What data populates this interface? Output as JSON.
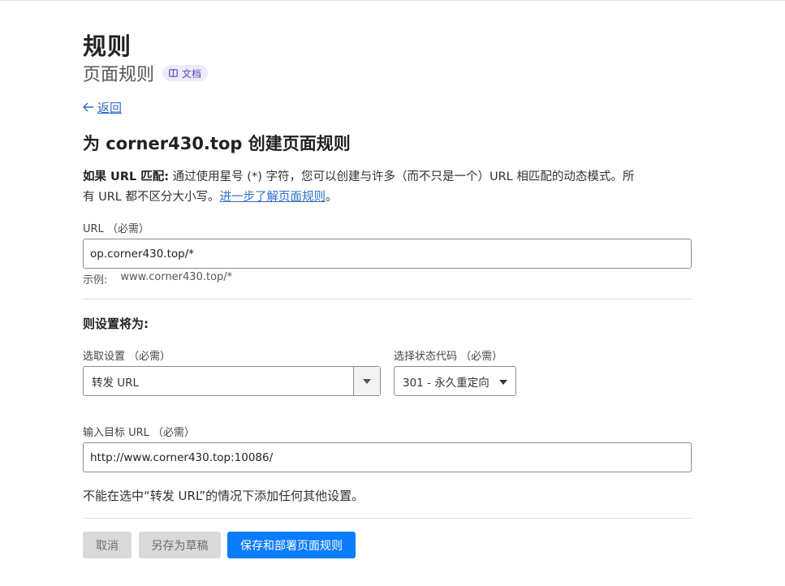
{
  "header": {
    "title": "规则",
    "subtitle": "页面规则",
    "doc_badge": "文档"
  },
  "back_link": "返回",
  "heading": "为 corner430.top 创建页面规则",
  "description": {
    "bold": "如果 URL 匹配:",
    "text_line1": " 通过使用星号 (*) 字符，您可以创建与许多（而不只是一个）URL 相匹配的动态模式。所",
    "text_line2": "有 URL 都不区分大小写。",
    "link": "进一步了解页面规则",
    "end": "。"
  },
  "url_field": {
    "label": "URL （必需）",
    "value": "op.corner430.top/*",
    "hint_prefix": "示例:",
    "hint_value": "www.corner430.top/*"
  },
  "settings": {
    "section_title": "则设置将为:",
    "pick_label": "选取设置 （必需）",
    "pick_value": "转发 URL",
    "status_label": "选择状态代码 （必需）",
    "status_value": "301 - 永久重定向",
    "target_label": "输入目标 URL （必需）",
    "target_value": "http://www.corner430.top:10086/",
    "note": "不能在选中“转发 URL”的情况下添加任何其他设置。"
  },
  "buttons": {
    "cancel": "取消",
    "draft": "另存为草稿",
    "save": "保存和部署页面规则"
  },
  "colors": {
    "primary": "#0a7cff",
    "link": "#2c6ecb",
    "badge_bg": "#eeeafb"
  }
}
